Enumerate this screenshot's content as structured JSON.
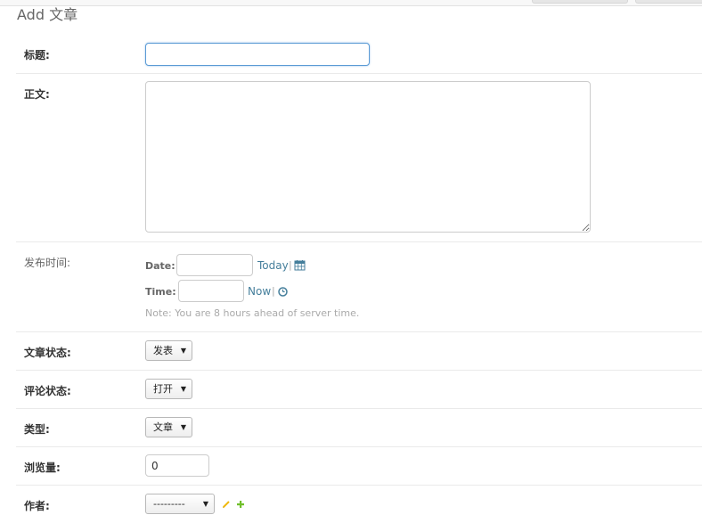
{
  "page": {
    "title": "Add 文章"
  },
  "fields": {
    "title": {
      "label": "标题:",
      "value": ""
    },
    "body": {
      "label": "正文:",
      "value": ""
    },
    "pub_time": {
      "label": "发布时间:",
      "date_label": "Date:",
      "date_value": "",
      "today_link": "Today",
      "separator": "|",
      "time_label": "Time:",
      "time_value": "",
      "now_link": "Now",
      "note": "Note: You are 8 hours ahead of server time.",
      "icons": [
        "calendar-icon",
        "clock-icon"
      ]
    },
    "status": {
      "label": "文章状态:",
      "selected": "发表"
    },
    "comment_status": {
      "label": "评论状态:",
      "selected": "打开"
    },
    "type": {
      "label": "类型:",
      "selected": "文章"
    },
    "views": {
      "label": "浏览量:",
      "value": "0"
    },
    "author": {
      "label": "作者:",
      "selected": "---------",
      "icons": [
        "pencil-icon",
        "add-icon"
      ]
    }
  },
  "colors": {
    "link": "#447e9b",
    "focus_border": "#5b9bd5",
    "add_icon": "#70bf2b",
    "pencil_icon": "#efb80b"
  }
}
